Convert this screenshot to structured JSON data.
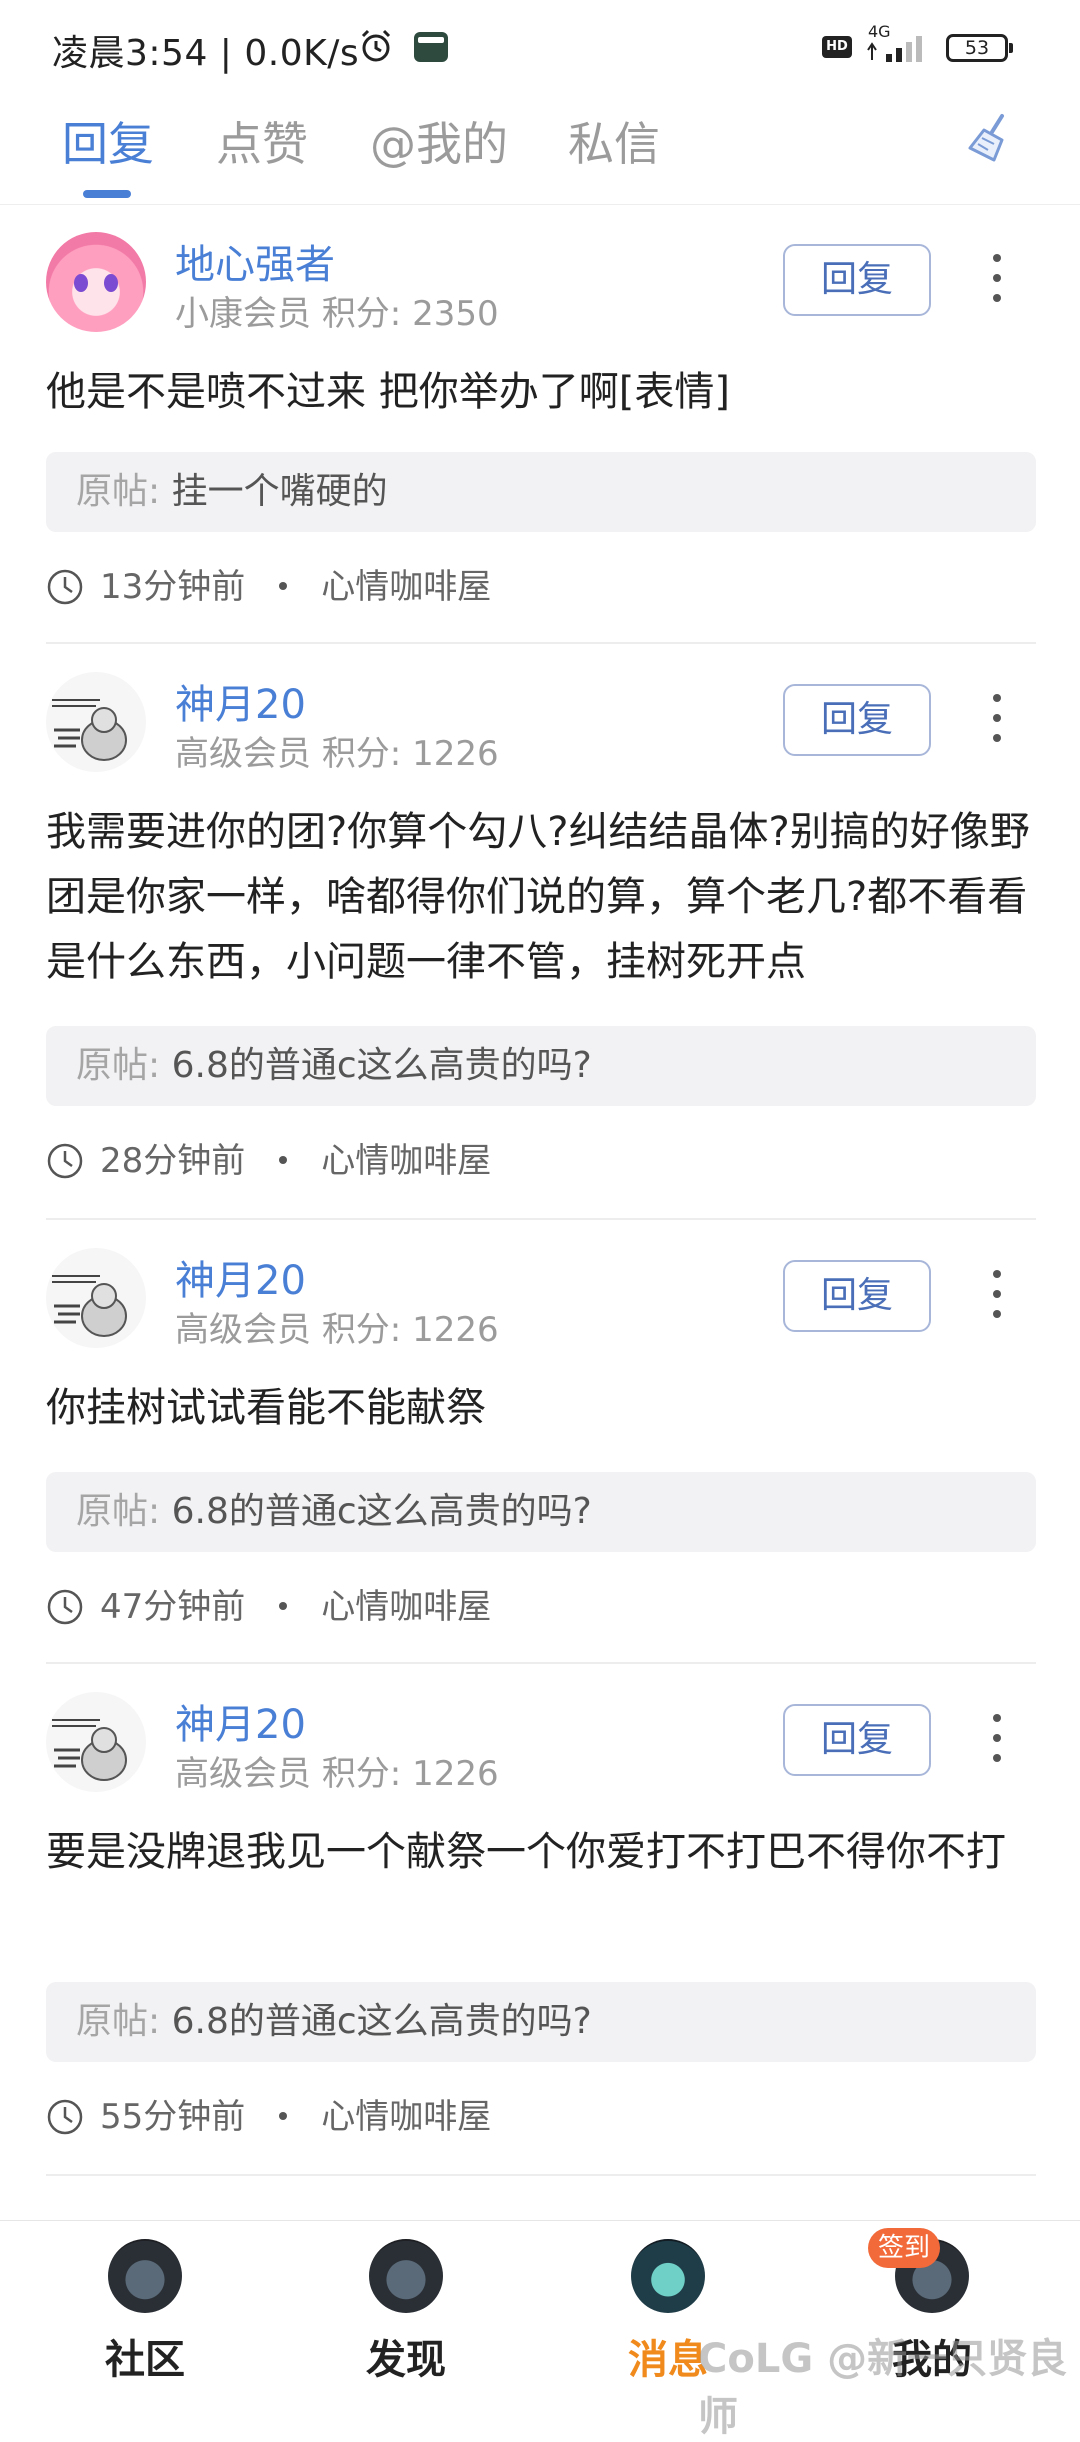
{
  "status_bar": {
    "time": "凌晨3:54 | 0.0K/s",
    "hd": "HD",
    "network": "4G",
    "battery": "53"
  },
  "tabs": [
    {
      "label": "回复",
      "active": true
    },
    {
      "label": "点赞",
      "active": false
    },
    {
      "label": "@我的",
      "active": false
    },
    {
      "label": "私信",
      "active": false
    }
  ],
  "messages": [
    {
      "username": "地心强者",
      "member_level": "小康会员",
      "points": "积分: 2350",
      "reply_label": "回复",
      "content": "他是不是喷不过来 把你举办了啊[表情]",
      "original_label": "原帖:",
      "original_title": "挂一个嘴硬的",
      "time_ago": "13分钟前",
      "forum": "心情咖啡屋"
    },
    {
      "username": "神月20",
      "member_level": "高级会员",
      "points": "积分: 1226",
      "reply_label": "回复",
      "content": "我需要进你的团?你算个勾八?纠结结晶体?别搞的好像野团是你家一样，啥都得你们说的算，算个老几?都不看看是什么东西，小问题一律不管，挂树死开点",
      "original_label": "原帖:",
      "original_title": "6.8的普通c这么高贵的吗?",
      "time_ago": "28分钟前",
      "forum": "心情咖啡屋"
    },
    {
      "username": "神月20",
      "member_level": "高级会员",
      "points": "积分: 1226",
      "reply_label": "回复",
      "content": "你挂树试试看能不能献祭",
      "original_label": "原帖:",
      "original_title": "6.8的普通c这么高贵的吗?",
      "time_ago": "47分钟前",
      "forum": "心情咖啡屋"
    },
    {
      "username": "神月20",
      "member_level": "高级会员",
      "points": "积分: 1226",
      "reply_label": "回复",
      "content": "要是没牌退我见一个献祭一个你爱打不打巴不得你不打",
      "original_label": "原帖:",
      "original_title": "6.8的普通c这么高贵的吗?",
      "time_ago": "55分钟前",
      "forum": "心情咖啡屋"
    }
  ],
  "bottom_nav": [
    {
      "label": "社区",
      "icon": "community-icon",
      "active": false
    },
    {
      "label": "发现",
      "icon": "discover-icon",
      "active": false
    },
    {
      "label": "消息",
      "icon": "message-icon",
      "active": true
    },
    {
      "label": "我的",
      "icon": "profile-icon",
      "active": false
    }
  ],
  "badge": "签到",
  "watermark": "CoLG @新一只贤良师",
  "colors": {
    "accent": "#4a7fd6",
    "active_nav": "#f08a1c",
    "badge": "#f26a3a"
  }
}
